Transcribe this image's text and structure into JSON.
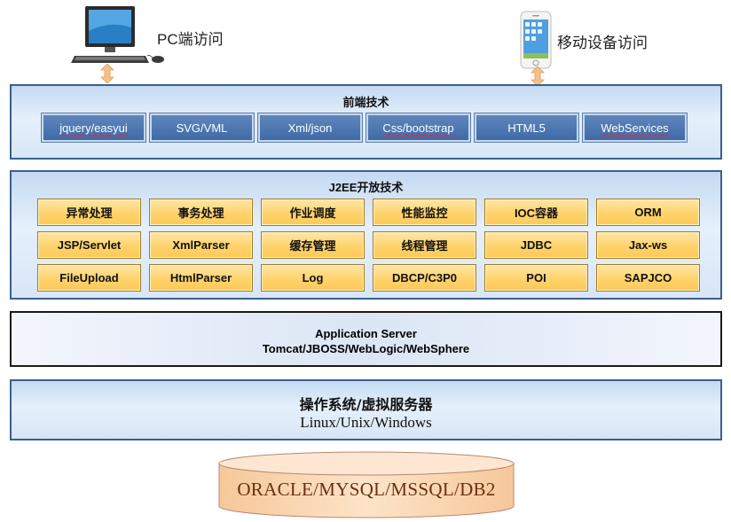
{
  "access": {
    "pc_label": "PC端访问",
    "mobile_label": "移动设备访问"
  },
  "frontend": {
    "title": "前端技术",
    "items": [
      {
        "label": "jquery/easyui"
      },
      {
        "label": "SVG/VML"
      },
      {
        "label": "Xml/json"
      },
      {
        "label": "Css/bootstrap"
      },
      {
        "label": "HTML5"
      },
      {
        "label": "WebServices"
      }
    ]
  },
  "j2ee": {
    "title": "J2EE开放技术",
    "items": [
      "异常处理",
      "事务处理",
      "作业调度",
      "性能监控",
      "IOC容器",
      "ORM",
      "JSP/Servlet",
      "XmlParser",
      "缓存管理",
      "线程管理",
      "JDBC",
      "Jax-ws",
      "FileUpload",
      "HtmlParser",
      "Log",
      "DBCP/C3P0",
      "POI",
      "SAPJCO"
    ]
  },
  "app_server": {
    "line1": "Application Server",
    "line2": "Tomcat/JBOSS/WebLogic/WebSphere"
  },
  "os": {
    "title": "操作系统/虚拟服务器",
    "subtitle": "Linux/Unix/Windows"
  },
  "database": {
    "label": "ORACLE/MYSQL/MSSQL/DB2"
  },
  "colors": {
    "panel_border": "#3a5f8f",
    "frontend_box": "#4a74ae",
    "j2ee_box": "#ffd36b",
    "db_fill": "#fdd9b5",
    "arrow": "#f7c08a"
  }
}
